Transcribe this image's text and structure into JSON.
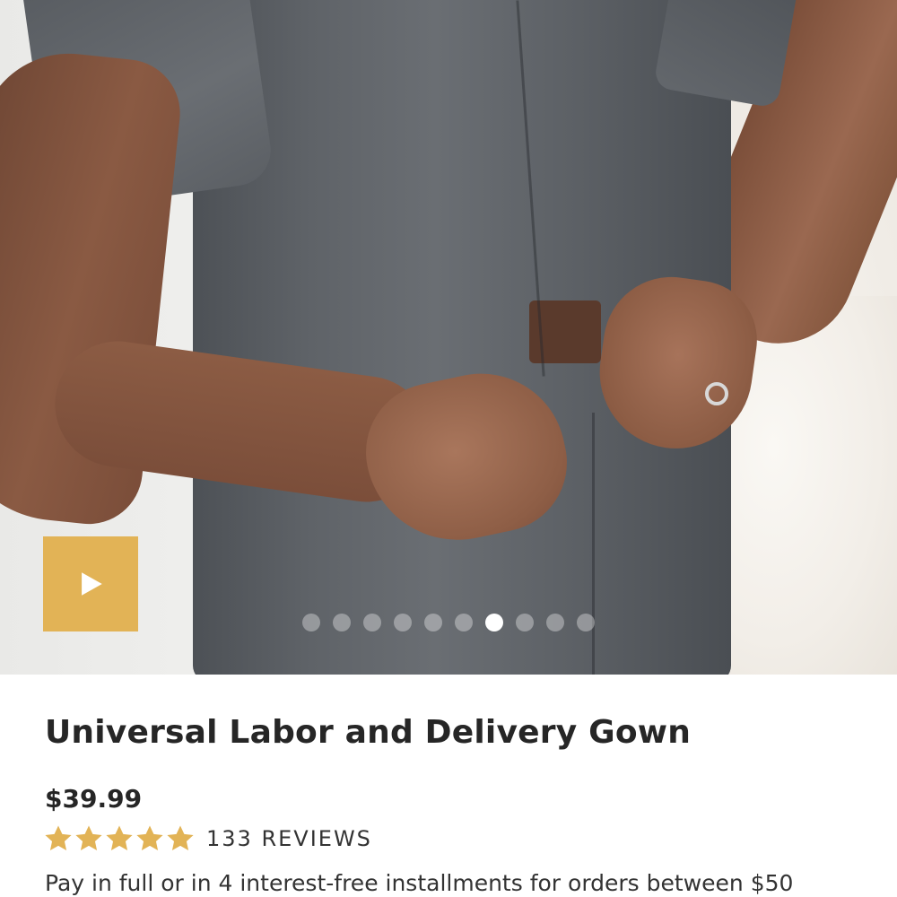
{
  "product": {
    "title": "Universal Labor and Delivery Gown",
    "price": "$39.99",
    "rating": 5,
    "reviews_label": "133 REVIEWS",
    "payment_note": "Pay in full or in 4 interest-free installments for orders between $50"
  },
  "gallery": {
    "dot_count": 10,
    "active_index": 6
  },
  "icons": {
    "play": "play-icon",
    "star": "star-icon"
  },
  "colors": {
    "accent_gold": "#e2b356",
    "star_gold": "#e2b356",
    "text_dark": "#262626"
  }
}
